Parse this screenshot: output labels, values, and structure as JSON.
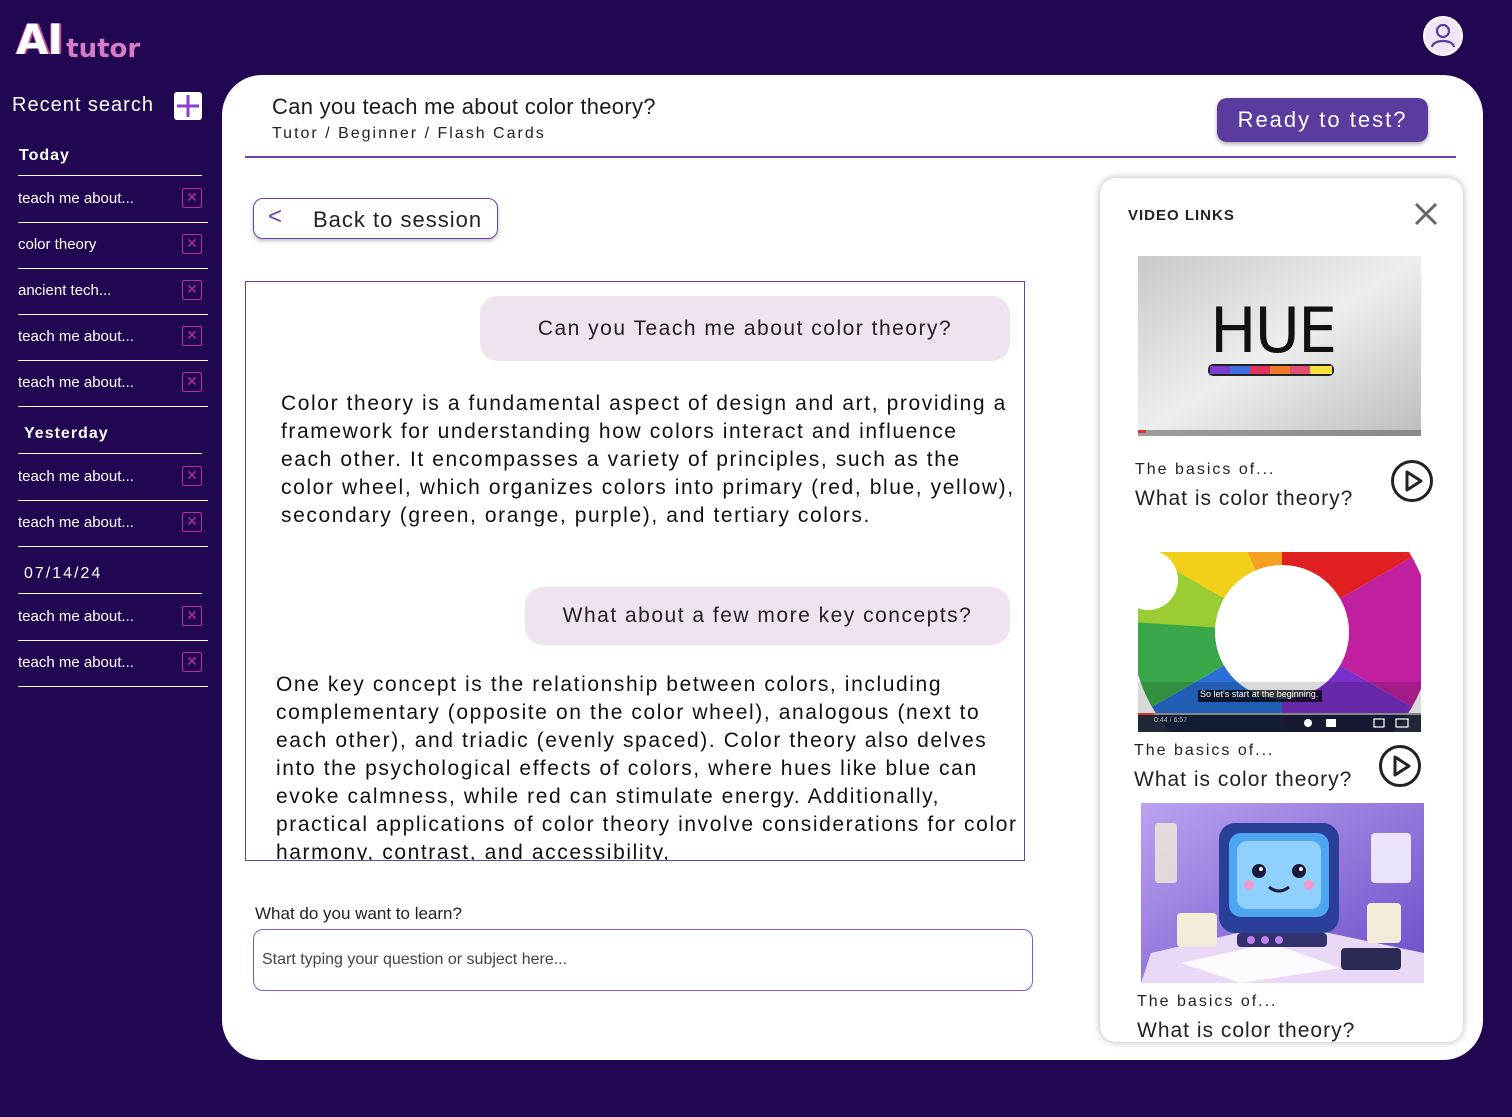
{
  "app": {
    "logo_main": "AI",
    "logo_sub": "tutor"
  },
  "sidebar": {
    "title": "Recent search",
    "groups": [
      {
        "label": "Today",
        "items": [
          "teach me about...",
          "color theory",
          "ancient tech...",
          "teach me about...",
          "teach me about..."
        ]
      },
      {
        "label": "Yesterday",
        "items": [
          "teach me about...",
          "teach me about..."
        ]
      },
      {
        "label": "07/14/24",
        "items": [
          "teach me about...",
          "teach me about..."
        ]
      }
    ]
  },
  "header": {
    "title": "Can you teach me about color theory?",
    "breadcrumb": "Tutor / Beginner / Flash Cards",
    "ready_button": "Ready to test?"
  },
  "session": {
    "back_label": "Back to session"
  },
  "chat": {
    "q1": "Can you Teach me about color theory?",
    "a1": "Color theory is a fundamental aspect of design and art, providing a framework for understanding how colors interact and influence each other. It encompasses a variety of principles, such as the color wheel, which organizes colors into primary (red, blue, yellow), secondary (green, orange, purple), and tertiary colors.",
    "q2": "What about a few more key concepts?",
    "a2": "One key concept is the relationship between colors, including complementary (opposite on the color wheel), analogous (next to each other), and triadic (evenly spaced). Color theory also delves into the psychological effects of colors, where hues like blue can evoke calmness, while red can stimulate energy. Additionally, practical applications of color theory involve considerations for color harmony, contrast, and accessibility,"
  },
  "learn": {
    "label": "What do you want to learn?",
    "placeholder": "Start typing your question or subject here...",
    "value": ""
  },
  "videos": {
    "title": "VIDEO LINKS",
    "items": [
      {
        "subtitle": "The basics of...",
        "title": "What is color theory?",
        "thumb_text": "HUE"
      },
      {
        "subtitle": "The basics of...",
        "title": "What is color theory?",
        "caption": "So let's start at the beginning.",
        "time": "0:44 / 6:57"
      },
      {
        "subtitle": "The basics of...",
        "title": "What is color theory?"
      }
    ]
  },
  "colors": {
    "background": "#210652",
    "accent": "#5b3b9e",
    "bubble": "#efe3f0",
    "close_x": "#b82f9c"
  }
}
